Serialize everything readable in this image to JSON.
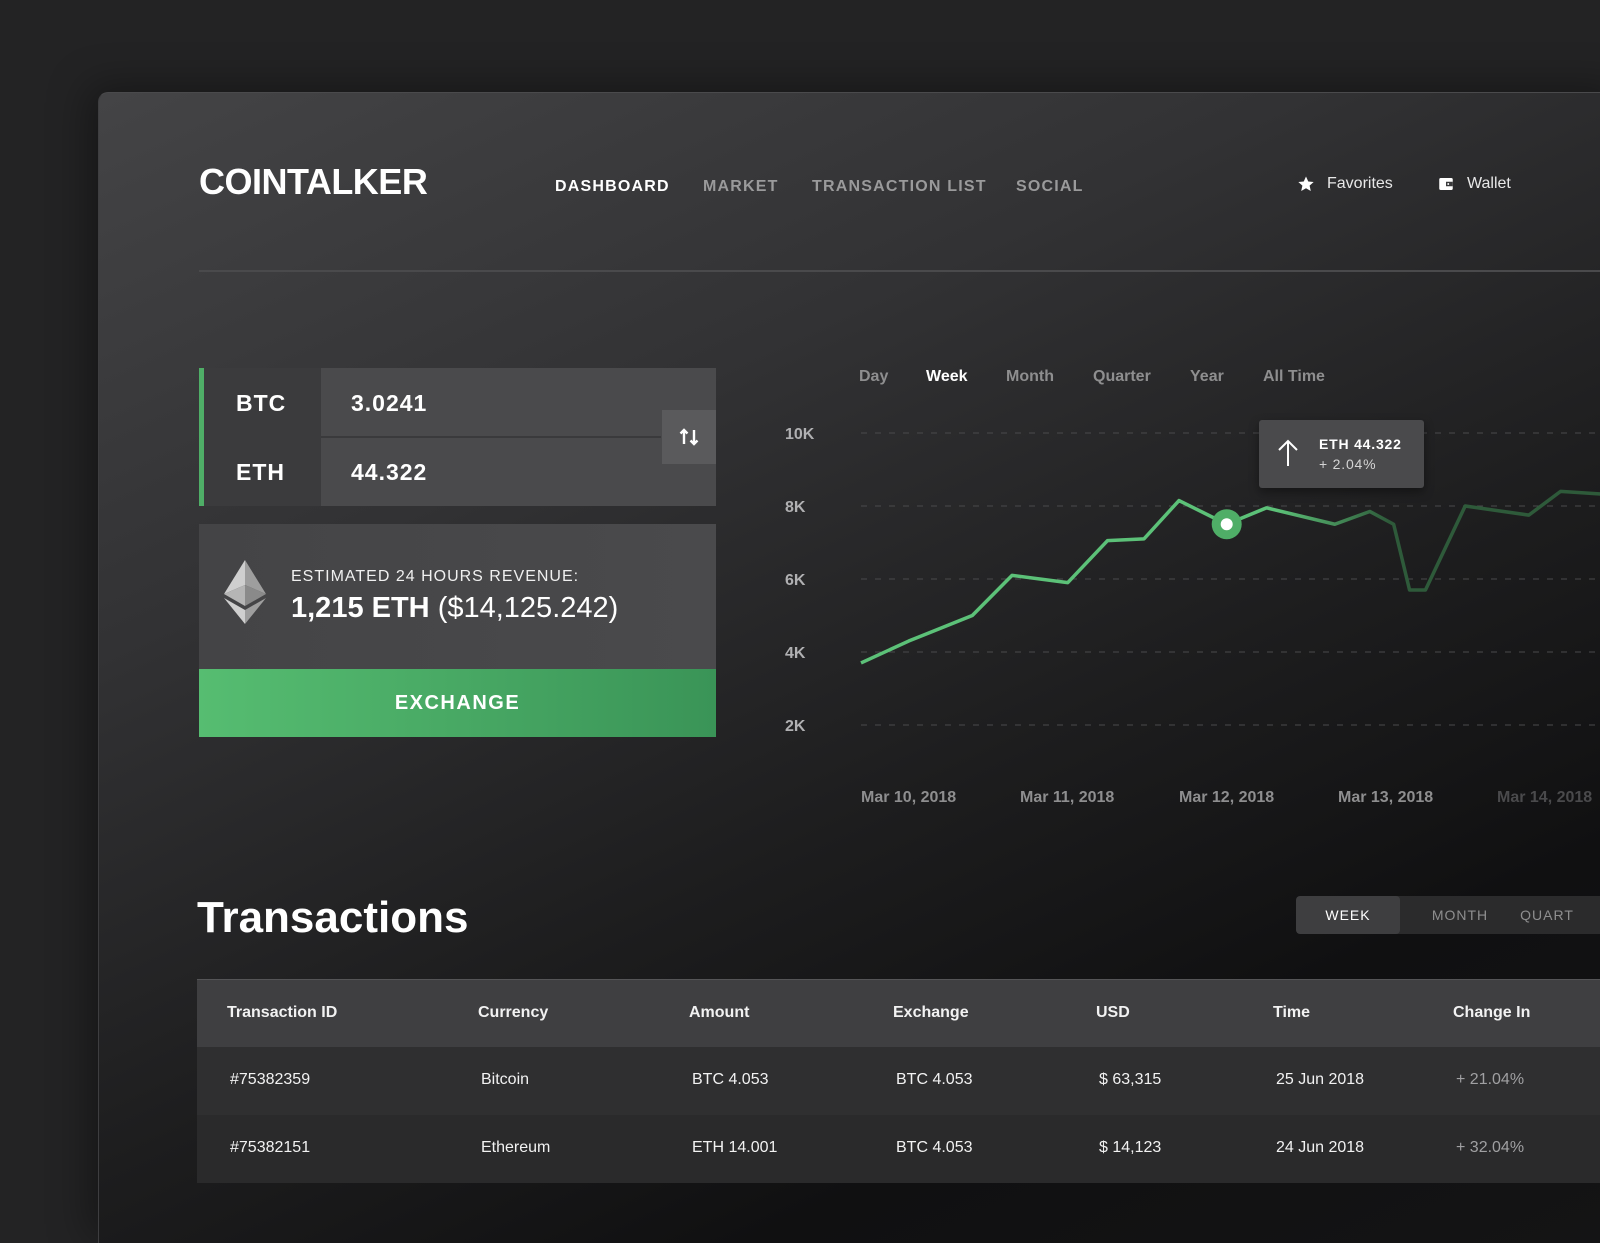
{
  "app": {
    "logo": "COINTALKER"
  },
  "nav": {
    "items": [
      {
        "label": "DASHBOARD",
        "active": true
      },
      {
        "label": "MARKET",
        "active": false
      },
      {
        "label": "TRANSACTION LIST",
        "active": false
      },
      {
        "label": "SOCIAL",
        "active": false
      }
    ]
  },
  "top_actions": {
    "favorites": {
      "label": "Favorites",
      "icon": "star-icon"
    },
    "wallet": {
      "label": "Wallet",
      "icon": "wallet-icon"
    }
  },
  "pair": {
    "from": {
      "symbol": "BTC",
      "value": "3.0241"
    },
    "to": {
      "symbol": "ETH",
      "value": "44.322"
    },
    "swap_icon": "swap-arrows-icon"
  },
  "revenue": {
    "label": "ESTIMATED 24 HOURS REVENUE:",
    "amount": "1,215 ETH",
    "usd": "($14,125.242)",
    "icon": "ethereum-icon"
  },
  "exchange_button": {
    "label": "EXCHANGE"
  },
  "range_tabs": [
    {
      "label": "Day",
      "active": false
    },
    {
      "label": "Week",
      "active": true
    },
    {
      "label": "Month",
      "active": false
    },
    {
      "label": "Quarter",
      "active": false
    },
    {
      "label": "Year",
      "active": false
    },
    {
      "label": "All Time",
      "active": false
    }
  ],
  "tooltip": {
    "title": "ETH 44.322",
    "change": "+ 2.04%",
    "icon": "arrow-up-icon"
  },
  "colors": {
    "accent": "#4fae67",
    "line": "#5cc178",
    "line_faded": "#2e5a3a"
  },
  "chart_data": {
    "type": "line",
    "y_ticks": [
      "10K",
      "8K",
      "6K",
      "4K",
      "2K"
    ],
    "ylim": [
      2000,
      10000
    ],
    "x_ticks": [
      "Mar 10, 2018",
      "Mar 11, 2018",
      "Mar 12, 2018",
      "Mar 13, 2018",
      "Mar 14, 2018"
    ],
    "x": [
      0,
      0.3,
      0.7,
      0.95,
      1.3,
      1.55,
      1.78,
      2.0,
      2.3,
      2.55,
      2.98,
      3.2,
      3.35,
      3.45,
      3.55,
      3.8,
      4.2,
      4.4,
      4.75
    ],
    "y": [
      3700,
      4300,
      5000,
      6100,
      5900,
      7050,
      7100,
      8150,
      7500,
      7950,
      7500,
      7850,
      7500,
      5700,
      5700,
      8000,
      7750,
      8400,
      8300
    ],
    "grid": true,
    "highlight_index": 8
  },
  "transactions": {
    "title": "Transactions",
    "periods": [
      {
        "label": "WEEK",
        "active": true
      },
      {
        "label": "MONTH",
        "active": false
      },
      {
        "label": "QUART",
        "active": false
      }
    ],
    "columns": [
      "Transaction ID",
      "Currency",
      "Amount",
      "Exchange",
      "USD",
      "Time",
      "Change In"
    ],
    "rows": [
      [
        "#75382359",
        "Bitcoin",
        "BTC 4.053",
        "BTC 4.053",
        "$ 63,315",
        "25 Jun 2018",
        "+ 21.04%"
      ],
      [
        "#75382151",
        "Ethereum",
        "ETH 14.001",
        "BTC 4.053",
        "$ 14,123",
        "24 Jun 2018",
        "+ 32.04%"
      ]
    ]
  }
}
